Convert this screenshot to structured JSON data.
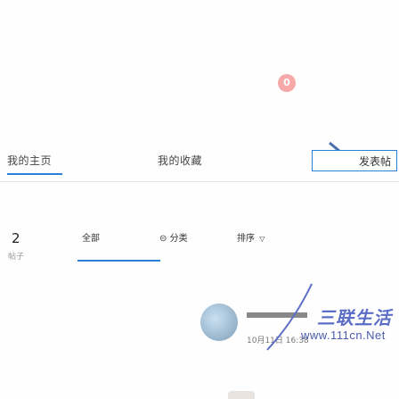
{
  "badge": {
    "count": "0"
  },
  "tabs": [
    {
      "label": "我的主页"
    },
    {
      "label": "我的收藏"
    },
    {
      "label": "发表帖"
    }
  ],
  "stats": {
    "count": "2",
    "count_label": "帖子",
    "items": [
      {
        "label": "全部"
      },
      {
        "label": "分类",
        "icon": "lock-icon"
      },
      {
        "label": "排序"
      }
    ]
  },
  "post": {
    "time": "10月11日 16:38"
  },
  "watermark": {
    "title": "三联生活",
    "url": "www.111cn.Net"
  },
  "colors": {
    "accent": "#2c7fd6",
    "badge": "#f7a9a9",
    "watermark": "#5b6dc6"
  }
}
